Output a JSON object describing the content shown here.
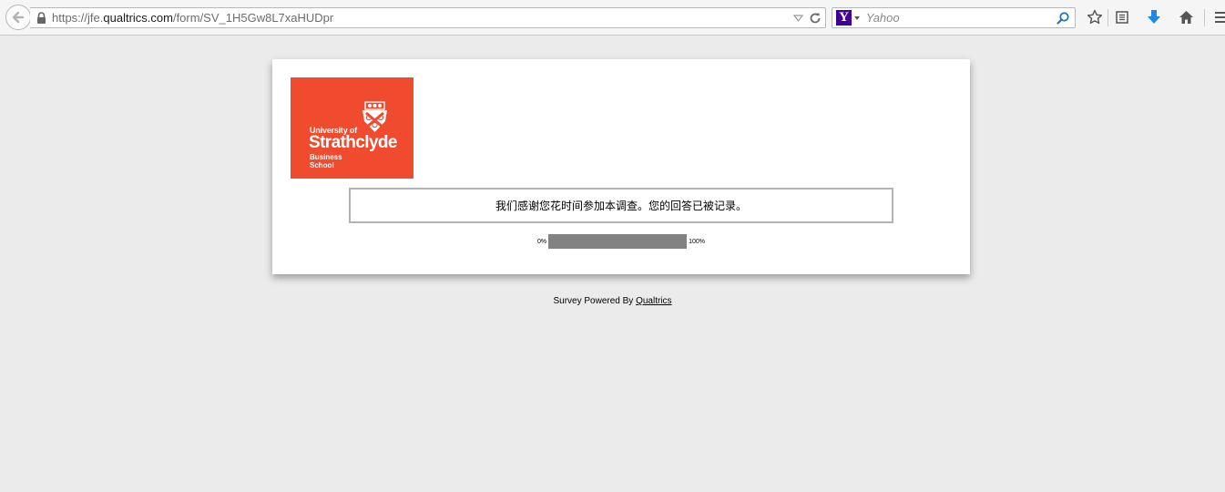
{
  "browser": {
    "url_prefix": "https://jfe.",
    "url_host": "qualtrics.com",
    "url_path": "/form/SV_1H5Gw8L7xaHUDpr",
    "search_engine_logo": "Y",
    "search_placeholder": "Yahoo",
    "icons": [
      "back-icon",
      "lock-icon",
      "dropdown-icon",
      "reload-icon",
      "search-icon",
      "bookmark-star-icon",
      "reading-list-icon",
      "download-icon",
      "home-icon",
      "menu-icon"
    ],
    "colors": {
      "download_icon": "#1e88e5",
      "yahoo_logo": "#410093"
    }
  },
  "survey": {
    "logo": {
      "line1": "University of",
      "line2": "Strathclyde",
      "line3a": "Business",
      "line3b": "School",
      "background": "#f04a2f"
    },
    "thanks_message": "我们感谢您花时间参加本调查。您的回答已被记录。",
    "progress": {
      "start_label": "0%",
      "end_label": "100%",
      "value": 1.0,
      "fill_color": "#828282"
    }
  },
  "footer": {
    "prefix": "Survey Powered By ",
    "link_text": "Qualtrics"
  }
}
